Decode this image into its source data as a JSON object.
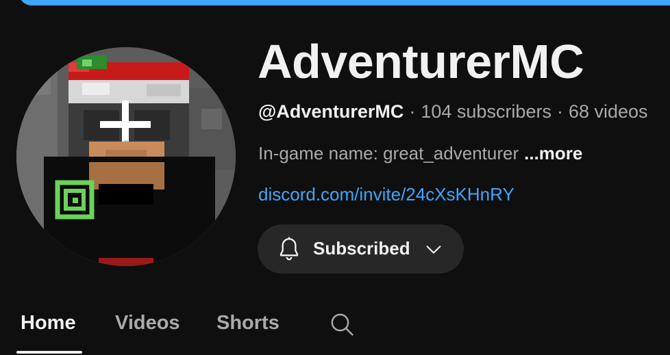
{
  "channel": {
    "name": "AdventurerMC",
    "handle": "@AdventurerMC",
    "subscribers": "104 subscribers",
    "videos": "68 videos",
    "separator": "·",
    "description": "In-game name: great_adventurer",
    "more_label": "...more",
    "link": "discord.com/invite/24cXsKHnRY"
  },
  "subscribe_button": {
    "label": "Subscribed",
    "bell_icon": "bell-icon",
    "chevron_icon": "chevron-down-icon"
  },
  "tabs": [
    {
      "label": "Home",
      "active": true
    },
    {
      "label": "Videos",
      "active": false
    },
    {
      "label": "Shorts",
      "active": false
    }
  ],
  "search_icon": "search-icon",
  "colors": {
    "background": "#0f0f0f",
    "accent": "#3ea6ff",
    "button_bg": "#272727",
    "primary_text": "#f1f1f1",
    "secondary_text": "#aaaaaa"
  }
}
